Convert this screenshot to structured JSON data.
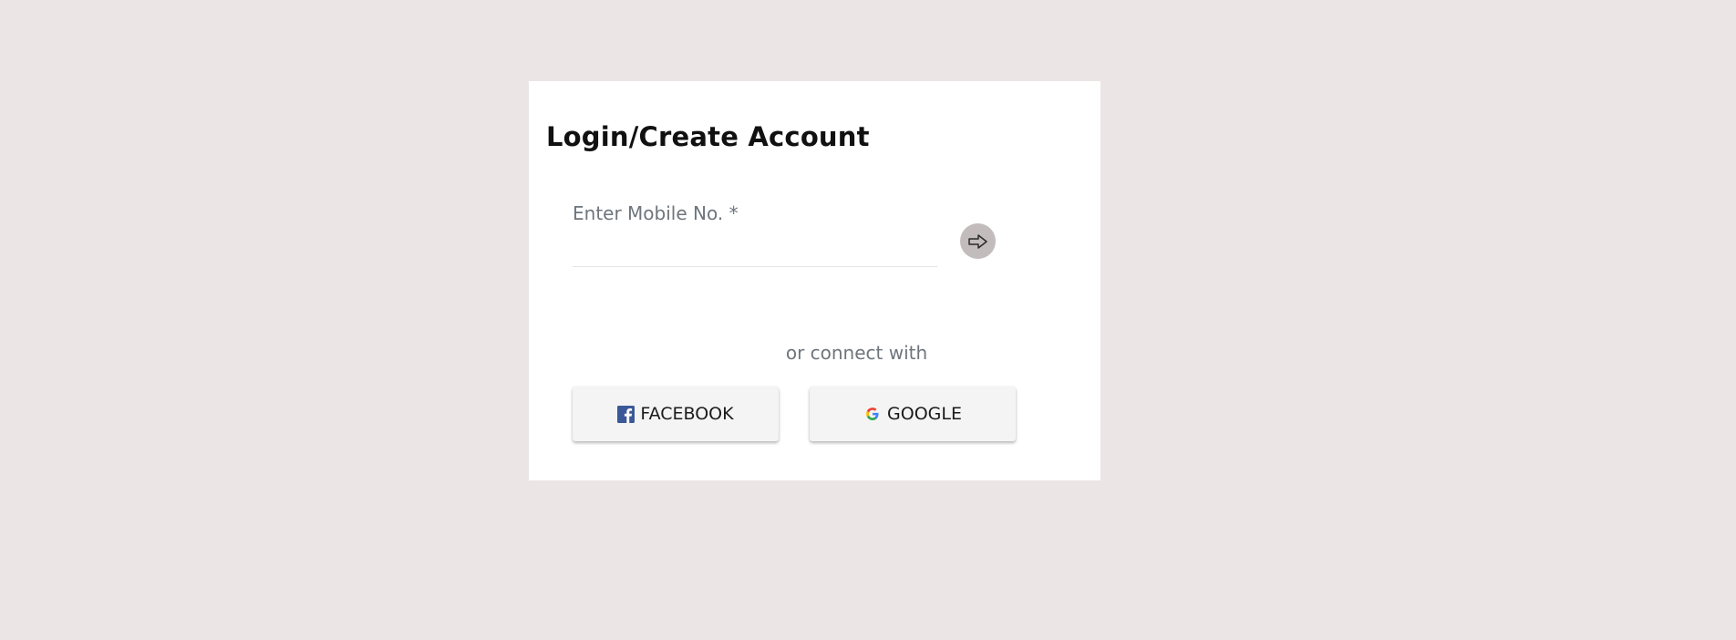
{
  "login": {
    "title": "Login/Create Account",
    "mobile_label": "Enter Mobile No. *",
    "mobile_value": "",
    "connect_text": "or connect with"
  },
  "social": {
    "facebook_label": "FACEBOOK",
    "google_label": "GOOGLE"
  },
  "icons": {
    "submit": "arrow-right-icon",
    "facebook": "facebook-icon",
    "google": "google-icon"
  },
  "colors": {
    "background": "#ebe5e5",
    "card": "#ffffff",
    "submit_button": "#c3bcbc",
    "facebook_blue": "#3b5998",
    "label_gray": "#6e757c"
  }
}
